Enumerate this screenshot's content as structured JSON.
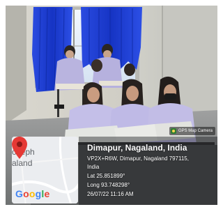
{
  "map_overlay": {
    "label_line_1": "oseph",
    "label_line_2": "aland",
    "logo_text": "Google",
    "pin_color": "#e53935"
  },
  "badge": {
    "text": "GPS Map Camera",
    "icon": "gps-map-camera-icon"
  },
  "location": {
    "title": "Dimapur, Nagaland, India",
    "address_line": "VP2X+R6W, Dimapur, Nagaland 797115,",
    "country_line": "India",
    "latitude": "Lat 25.851899°",
    "longitude": "Long 93.748298°",
    "timestamp": "26/07/22 11:16 AM"
  },
  "colors": {
    "panel_bg": "rgba(10,12,18,0.40)",
    "curtain_blue": "#1f3fd6",
    "uniform_lavender": "#c2bde6"
  }
}
